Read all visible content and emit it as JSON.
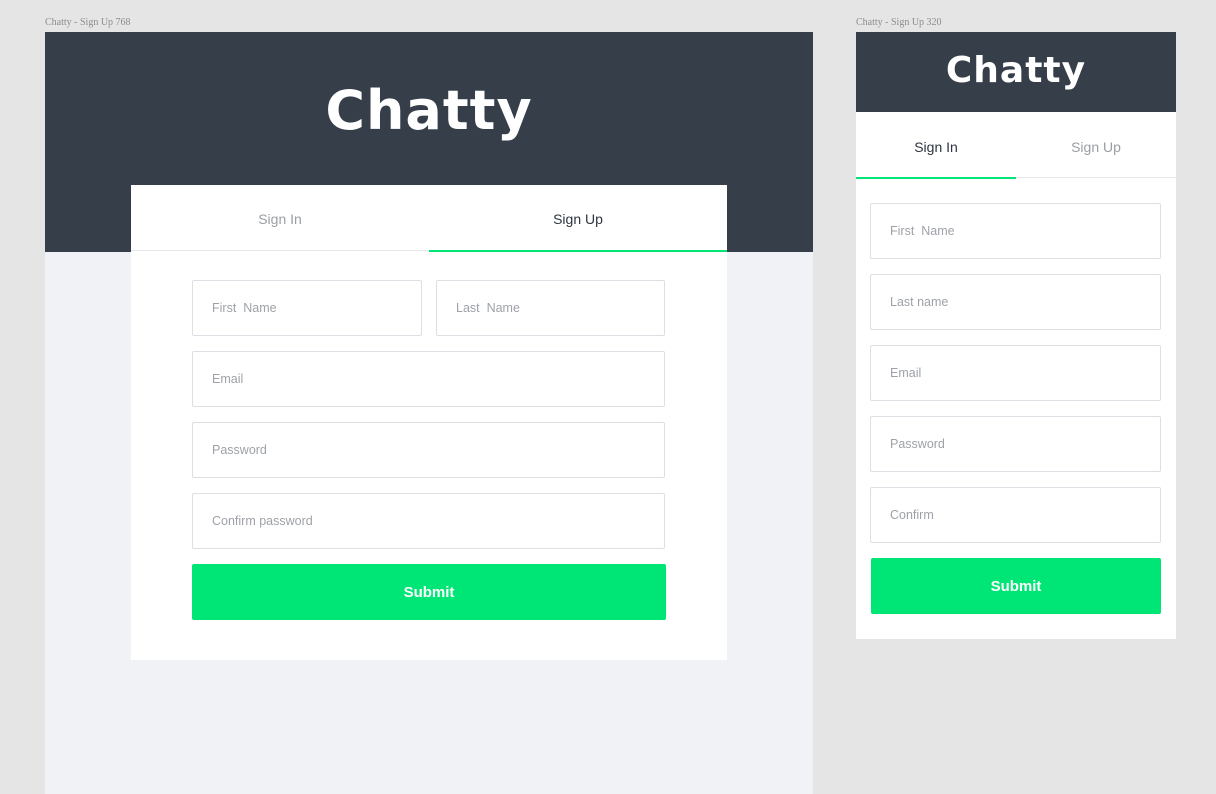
{
  "artboards": {
    "tablet": {
      "label": "Chatty - Sign Up 768",
      "logo": "Chatty",
      "tabs": {
        "sign_in": "Sign In",
        "sign_up": "Sign Up",
        "active": "sign_up"
      },
      "fields": {
        "first_name": "First  Name",
        "last_name": "Last  Name",
        "email": "Email",
        "password": "Password",
        "confirm": "Confirm password"
      },
      "submit": "Submit"
    },
    "mobile": {
      "label": "Chatty - Sign Up 320",
      "logo": "Chatty",
      "tabs": {
        "sign_in": "Sign In",
        "sign_up": "Sign Up",
        "active": "sign_in"
      },
      "fields": {
        "first_name": "First  Name",
        "last_name": "Last name",
        "email": "Email",
        "password": "Password",
        "confirm": "Confirm"
      },
      "submit": "Submit"
    }
  },
  "colors": {
    "header": "#363e49",
    "accent": "#00e676",
    "page_bg": "#f0f2f5",
    "canvas_bg": "#e5e5e5"
  }
}
